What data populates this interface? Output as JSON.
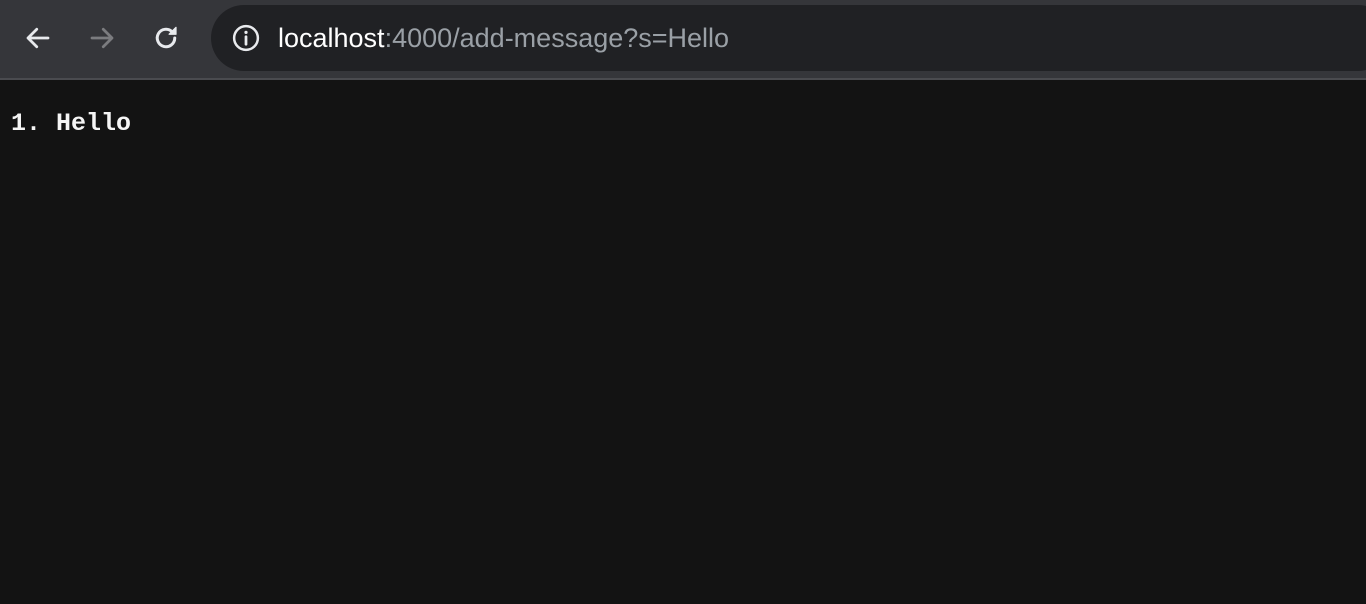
{
  "browser": {
    "back_icon": "arrow-left-icon",
    "forward_icon": "arrow-right-icon",
    "reload_icon": "reload-icon",
    "site_info_icon": "info-icon",
    "url_host": "localhost",
    "url_rest": ":4000/add-message?s=Hello",
    "colors": {
      "toolbar": "#35363a",
      "omnibox": "#202124",
      "page_background": "#131313"
    }
  },
  "page": {
    "messages": [
      {
        "number": "1.",
        "text": "Hello"
      }
    ]
  }
}
